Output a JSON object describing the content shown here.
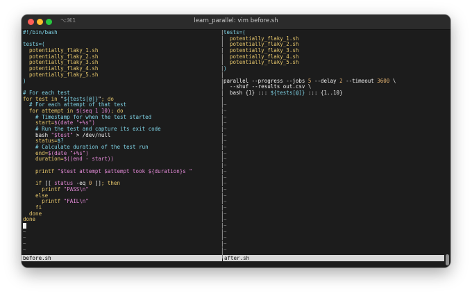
{
  "window": {
    "title": "learn_parallel: vim before.sh",
    "shortcut": "⌥⌘1"
  },
  "left_pane": {
    "filename": "before.sh",
    "lines": [
      [
        {
          "t": "#!/bin/bash",
          "c": "c"
        }
      ],
      [],
      [
        {
          "t": "tests=(",
          "c": "c"
        }
      ],
      [
        {
          "t": "  potentially_flaky_1.sh",
          "c": "y"
        }
      ],
      [
        {
          "t": "  potentially_flaky_2.sh",
          "c": "y"
        }
      ],
      [
        {
          "t": "  potentially_flaky_3.sh",
          "c": "y"
        }
      ],
      [
        {
          "t": "  potentially_flaky_4.sh",
          "c": "y"
        }
      ],
      [
        {
          "t": "  potentially_flaky_5.sh",
          "c": "y"
        }
      ],
      [
        {
          "t": ")",
          "c": "c"
        }
      ],
      [],
      [
        {
          "t": "# For each test",
          "c": "c"
        }
      ],
      [
        {
          "t": "for test in ",
          "c": "y"
        },
        {
          "t": "\"",
          "c": "w"
        },
        {
          "t": "${tests[@]}",
          "c": "c"
        },
        {
          "t": "\"",
          "c": "w"
        },
        {
          "t": "; do",
          "c": "y"
        }
      ],
      [
        {
          "t": "  # For each attempt of that test",
          "c": "c"
        }
      ],
      [
        {
          "t": "  for attempt in ",
          "c": "y"
        },
        {
          "t": "$(seq 1 10)",
          "c": "m"
        },
        {
          "t": "; do",
          "c": "y"
        }
      ],
      [
        {
          "t": "    # Timestamp for when the test started",
          "c": "c"
        }
      ],
      [
        {
          "t": "    start=",
          "c": "y"
        },
        {
          "t": "$(date \"+%s\")",
          "c": "m"
        }
      ],
      [
        {
          "t": "    # Run the test and capture its exit code",
          "c": "c"
        }
      ],
      [
        {
          "t": "    bash ",
          "c": "w"
        },
        {
          "t": "\"$test\"",
          "c": "m"
        },
        {
          "t": " > /dev/null",
          "c": "w"
        }
      ],
      [
        {
          "t": "    status=",
          "c": "y"
        },
        {
          "t": "$?",
          "c": "c"
        }
      ],
      [
        {
          "t": "    # Calculate duration of the test run",
          "c": "c"
        }
      ],
      [
        {
          "t": "    end=",
          "c": "y"
        },
        {
          "t": "$(date \"+%s\")",
          "c": "m"
        }
      ],
      [
        {
          "t": "    duration=",
          "c": "y"
        },
        {
          "t": "$((end - start))",
          "c": "m"
        }
      ],
      [],
      [
        {
          "t": "    printf ",
          "c": "y"
        },
        {
          "t": "\"$test attempt $attempt took ${duration}s \"",
          "c": "m"
        }
      ],
      [],
      [
        {
          "t": "    if ",
          "c": "y"
        },
        {
          "t": "[[ ",
          "c": "w"
        },
        {
          "t": "status",
          "c": "m"
        },
        {
          "t": " -eq ",
          "c": "w"
        },
        {
          "t": "0",
          "c": "o"
        },
        {
          "t": " ]]",
          "c": "w"
        },
        {
          "t": "; then",
          "c": "y"
        }
      ],
      [
        {
          "t": "      printf ",
          "c": "y"
        },
        {
          "t": "\"PASS\\n\"",
          "c": "m"
        }
      ],
      [
        {
          "t": "    else",
          "c": "y"
        }
      ],
      [
        {
          "t": "      printf ",
          "c": "y"
        },
        {
          "t": "\"FAIL\\n\"",
          "c": "m"
        }
      ],
      [
        {
          "t": "    fi",
          "c": "y"
        }
      ],
      [
        {
          "t": "  done",
          "c": "y"
        }
      ],
      [
        {
          "t": "done",
          "c": "y"
        }
      ],
      [
        {
          "t": "cursor",
          "c": "cursor"
        }
      ],
      [
        {
          "t": "~",
          "c": "t"
        }
      ],
      [
        {
          "t": "~",
          "c": "t"
        }
      ],
      [
        {
          "t": "~",
          "c": "t"
        }
      ],
      [
        {
          "t": "~",
          "c": "t"
        }
      ]
    ]
  },
  "right_pane": {
    "filename": "after.sh",
    "lines": [
      [
        {
          "t": "tests=(",
          "c": "c"
        }
      ],
      [
        {
          "t": "  potentially_flaky_1.sh",
          "c": "y"
        }
      ],
      [
        {
          "t": "  potentially_flaky_2.sh",
          "c": "y"
        }
      ],
      [
        {
          "t": "  potentially_flaky_3.sh",
          "c": "y"
        }
      ],
      [
        {
          "t": "  potentially_flaky_4.sh",
          "c": "y"
        }
      ],
      [
        {
          "t": "  potentially_flaky_5.sh",
          "c": "y"
        }
      ],
      [
        {
          "t": ")",
          "c": "c"
        }
      ],
      [],
      [
        {
          "t": "parallel --progress --jobs ",
          "c": "w"
        },
        {
          "t": "5",
          "c": "o"
        },
        {
          "t": " --delay ",
          "c": "w"
        },
        {
          "t": "2",
          "c": "o"
        },
        {
          "t": " --timeout ",
          "c": "w"
        },
        {
          "t": "3600",
          "c": "o"
        },
        {
          "t": " \\",
          "c": "w"
        }
      ],
      [
        {
          "t": "  --shuf --results out.csv \\",
          "c": "w"
        }
      ],
      [
        {
          "t": "  bash {1} ::: ",
          "c": "w"
        },
        {
          "t": "${tests[@]}",
          "c": "c"
        },
        {
          "t": " ::: {1..10}",
          "c": "w"
        }
      ],
      [],
      [
        {
          "t": "~",
          "c": "t"
        }
      ],
      [
        {
          "t": "~",
          "c": "t"
        }
      ],
      [
        {
          "t": "~",
          "c": "t"
        }
      ],
      [
        {
          "t": "~",
          "c": "t"
        }
      ],
      [
        {
          "t": "~",
          "c": "t"
        }
      ],
      [
        {
          "t": "~",
          "c": "t"
        }
      ],
      [
        {
          "t": "~",
          "c": "t"
        }
      ],
      [
        {
          "t": "~",
          "c": "t"
        }
      ],
      [
        {
          "t": "~",
          "c": "t"
        }
      ],
      [
        {
          "t": "~",
          "c": "t"
        }
      ],
      [
        {
          "t": "~",
          "c": "t"
        }
      ],
      [
        {
          "t": "~",
          "c": "t"
        }
      ],
      [
        {
          "t": "~",
          "c": "t"
        }
      ],
      [
        {
          "t": "~",
          "c": "t"
        }
      ],
      [
        {
          "t": "~",
          "c": "t"
        }
      ],
      [
        {
          "t": "~",
          "c": "t"
        }
      ],
      [
        {
          "t": "~",
          "c": "t"
        }
      ],
      [
        {
          "t": "~",
          "c": "t"
        }
      ],
      [
        {
          "t": "~",
          "c": "t"
        }
      ],
      [
        {
          "t": "~",
          "c": "t"
        }
      ],
      [
        {
          "t": "~",
          "c": "t"
        }
      ],
      [
        {
          "t": "~",
          "c": "t"
        }
      ],
      [
        {
          "t": "~",
          "c": "t"
        }
      ],
      [
        {
          "t": "~",
          "c": "t"
        }
      ],
      [
        {
          "t": "~",
          "c": "t"
        }
      ]
    ]
  },
  "divider_char": "|"
}
